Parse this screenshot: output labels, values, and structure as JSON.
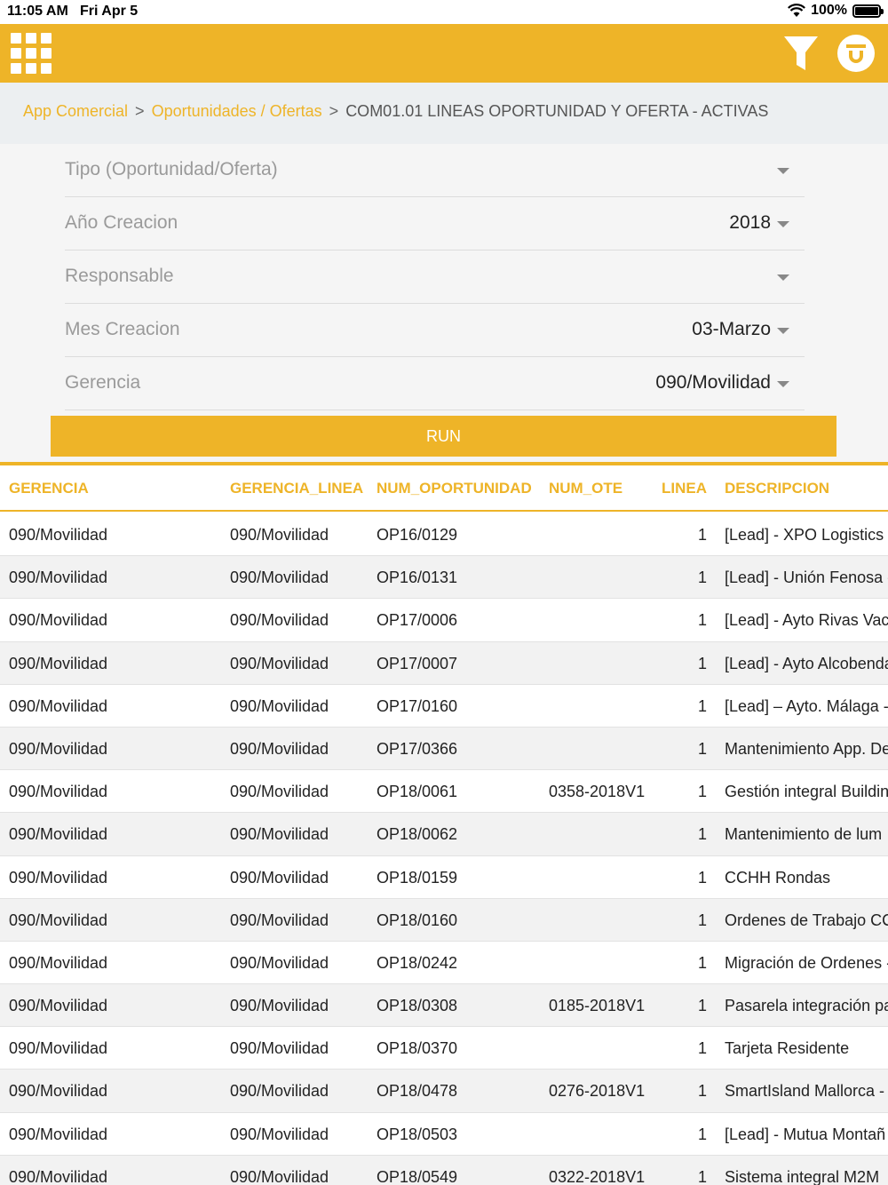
{
  "status": {
    "time": "11:05 AM",
    "date": "Fri Apr 5",
    "battery": "100%",
    "battery_level": 1.0
  },
  "header": {
    "menu_icon": "grid-menu-icon",
    "filter_icon": "filter-icon",
    "user_icon": "user-icon",
    "accent_color": "#eeb428"
  },
  "breadcrumb": {
    "items": [
      "App Comercial",
      "Oportunidades / Ofertas"
    ],
    "separator": ">",
    "current": "COM01.01 LINEAS OPORTUNIDAD Y OFERTA - ACTIVAS"
  },
  "filters": [
    {
      "label": "Tipo (Oportunidad/Oferta)",
      "value": ""
    },
    {
      "label": "Año Creacion",
      "value": "2018"
    },
    {
      "label": "Responsable",
      "value": ""
    },
    {
      "label": "Mes Creacion",
      "value": "03-Marzo"
    },
    {
      "label": "Gerencia",
      "value": "090/Movilidad"
    }
  ],
  "run_label": "RUN",
  "table": {
    "columns": [
      "GERENCIA",
      "GERENCIA_LINEA",
      "NUM_OPORTUNIDAD",
      "NUM_OTE",
      "LINEA",
      "DESCRIPCION"
    ],
    "rows": [
      [
        "090/Movilidad",
        "090/Movilidad",
        "OP16/0129",
        "",
        "1",
        "[Lead] - XPO Logistics -"
      ],
      [
        "090/Movilidad",
        "090/Movilidad",
        "OP16/0131",
        "",
        "1",
        "[Lead] - Unión Fenosa -"
      ],
      [
        "090/Movilidad",
        "090/Movilidad",
        "OP17/0006",
        "",
        "1",
        "[Lead] - Ayto Rivas Vac"
      ],
      [
        "090/Movilidad",
        "090/Movilidad",
        "OP17/0007",
        "",
        "1",
        "[Lead] - Ayto Alcobenda"
      ],
      [
        "090/Movilidad",
        "090/Movilidad",
        "OP17/0160",
        "",
        "1",
        "[Lead] – Ayto. Málaga -"
      ],
      [
        "090/Movilidad",
        "090/Movilidad",
        "OP17/0366",
        "",
        "1",
        "Mantenimiento App. De"
      ],
      [
        "090/Movilidad",
        "090/Movilidad",
        "OP18/0061",
        "0358-2018V1",
        "1",
        "Gestión integral Buildin"
      ],
      [
        "090/Movilidad",
        "090/Movilidad",
        "OP18/0062",
        "",
        "1",
        "Mantenimiento de lum"
      ],
      [
        "090/Movilidad",
        "090/Movilidad",
        "OP18/0159",
        "",
        "1",
        "CCHH Rondas"
      ],
      [
        "090/Movilidad",
        "090/Movilidad",
        "OP18/0160",
        "",
        "1",
        "Ordenes de Trabajo CC"
      ],
      [
        "090/Movilidad",
        "090/Movilidad",
        "OP18/0242",
        "",
        "1",
        "Migración de Ordenes -"
      ],
      [
        "090/Movilidad",
        "090/Movilidad",
        "OP18/0308",
        "0185-2018V1",
        "1",
        "Pasarela integración pa"
      ],
      [
        "090/Movilidad",
        "090/Movilidad",
        "OP18/0370",
        "",
        "1",
        "Tarjeta Residente"
      ],
      [
        "090/Movilidad",
        "090/Movilidad",
        "OP18/0478",
        "0276-2018V1",
        "1",
        "SmartIsland Mallorca -"
      ],
      [
        "090/Movilidad",
        "090/Movilidad",
        "OP18/0503",
        "",
        "1",
        "[Lead] - Mutua Montañ"
      ],
      [
        "090/Movilidad",
        "090/Movilidad",
        "OP18/0549",
        "0322-2018V1",
        "1",
        "Sistema integral M2M"
      ]
    ]
  }
}
